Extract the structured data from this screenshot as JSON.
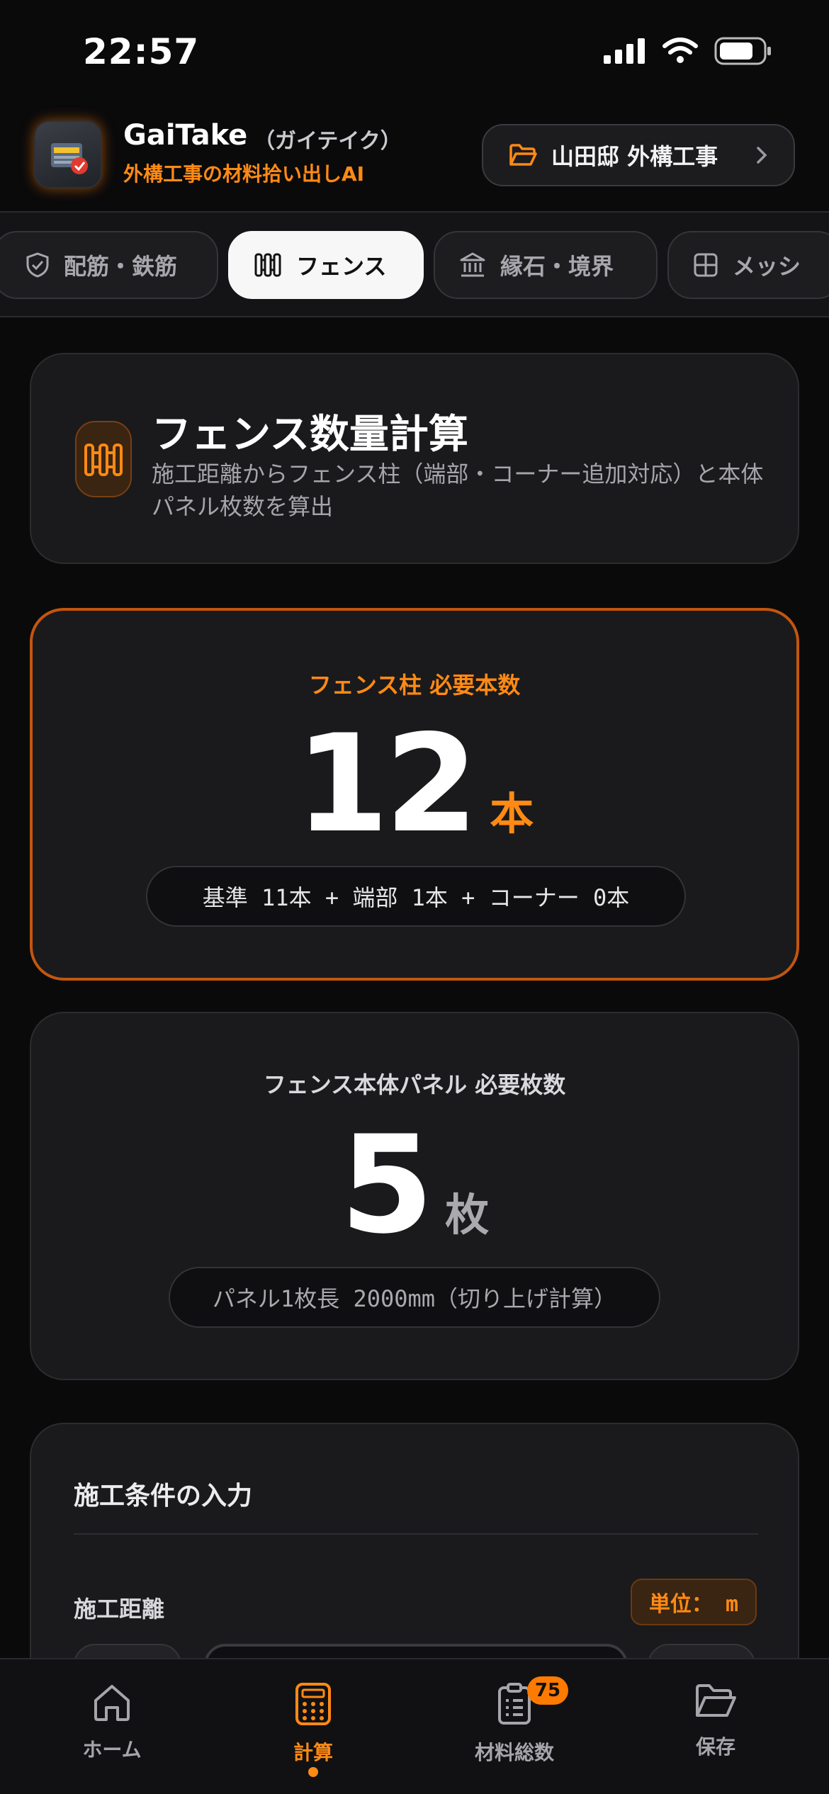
{
  "status_bar": {
    "time": "22:57"
  },
  "header": {
    "app_name": "GaiTake",
    "app_name_kana": "（ガイテイク）",
    "tagline": "外構工事の材料拾い出しAI",
    "project_label": "山田邸 外構工事"
  },
  "tabs": [
    {
      "label": "配筋・鉄筋",
      "icon": "shield-check-icon"
    },
    {
      "label": "フェンス",
      "icon": "fence-icon",
      "active": true
    },
    {
      "label": "縁石・境界",
      "icon": "bank-icon"
    },
    {
      "label": "メッシ",
      "icon": "grid-icon"
    }
  ],
  "hero": {
    "title": "フェンス数量計算",
    "description": "施工距離からフェンス柱（端部・コーナー追加対応）と本体パネル枚数を算出"
  },
  "posts": {
    "label": "フェンス柱  必要本数",
    "value": "12",
    "unit": "本",
    "breakdown": "基準 11本 + 端部 1本 + コーナー 0本"
  },
  "panels": {
    "label": "フェンス本体パネル  必要枚数",
    "value": "5",
    "unit": "枚",
    "note": "パネル1枚長 2000mm（切り上げ計算）"
  },
  "conditions": {
    "title": "施工条件の入力",
    "distance_label": "施工距離",
    "unit_badge": "単位： m"
  },
  "bottom_nav": [
    {
      "label": "ホーム",
      "icon": "home-icon"
    },
    {
      "label": "計算",
      "icon": "calculator-icon",
      "active": true
    },
    {
      "label": "材料総数",
      "icon": "clipboard-icon",
      "badge": "75"
    },
    {
      "label": "保存",
      "icon": "folder-open-icon"
    }
  ],
  "colors": {
    "accent": "#ff8a14",
    "background": "#0a0a0b",
    "card": "#1a1a1c"
  }
}
